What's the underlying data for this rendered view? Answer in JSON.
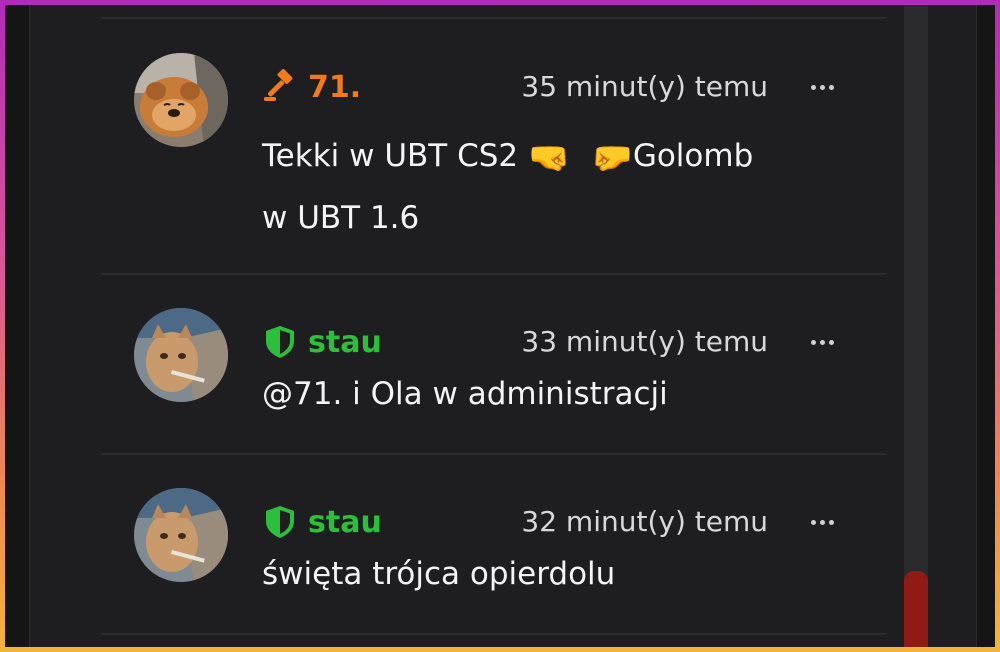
{
  "comments": [
    {
      "author": "71.",
      "author_color": "#f27a1a",
      "role_icon": "gavel-icon",
      "time": "35 minut(y) temu",
      "text_part1": "Tekki w UBT CS2",
      "emoji_left": "🤜",
      "emoji_right": "🤛",
      "text_part2": "Golomb",
      "text_line2": "w UBT 1.6"
    },
    {
      "author": "stau",
      "author_color": "#2bbf3b",
      "role_icon": "shield-icon",
      "time": "33 minut(y) temu",
      "text": "@71. i Ola w administracji"
    },
    {
      "author": "stau",
      "author_color": "#2bbf3b",
      "role_icon": "shield-icon",
      "time": "32 minut(y) temu",
      "text": "święta trójca opierdolu"
    }
  ],
  "colors": {
    "background": "#1e1e20",
    "scroll_thumb": "#8f1a16",
    "frame_gradient_top": "#b22bb8",
    "frame_gradient_bottom": "#f3b53a"
  }
}
